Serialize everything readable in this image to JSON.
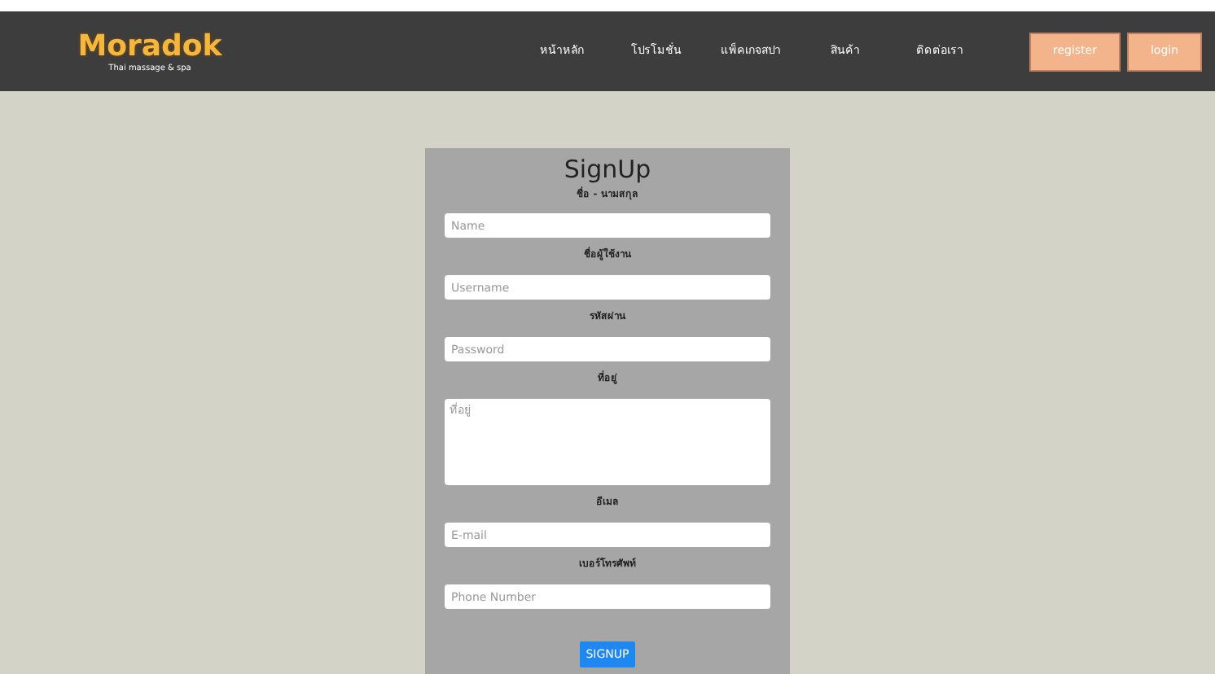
{
  "logo": {
    "name": "Moradok",
    "tagline": "Thai massage & spa"
  },
  "nav": [
    "หน้าหลัก",
    "โปรโมชั่น",
    "แพ็คเกจสปา",
    "สินค้า",
    "ติดต่อเรา"
  ],
  "auth_buttons": [
    "register",
    "login"
  ],
  "form": {
    "title": "SignUp",
    "fields": [
      {
        "label": "ชื่อ - นามสกุล",
        "placeholder": "Name",
        "kind": "input"
      },
      {
        "label": "ชื่อผู้ใช้งาน",
        "placeholder": "Username",
        "kind": "input"
      },
      {
        "label": "รหัสผ่าน",
        "placeholder": "Password",
        "kind": "input"
      },
      {
        "label": "ที่อยู่",
        "placeholder": "ที่อยู่",
        "kind": "textarea"
      },
      {
        "label": "อีเมล",
        "placeholder": "E-mail",
        "kind": "input"
      },
      {
        "label": "เบอร์โทรศัพท์",
        "placeholder": "Phone Number",
        "kind": "input"
      }
    ],
    "submit": "SIGNUP"
  }
}
